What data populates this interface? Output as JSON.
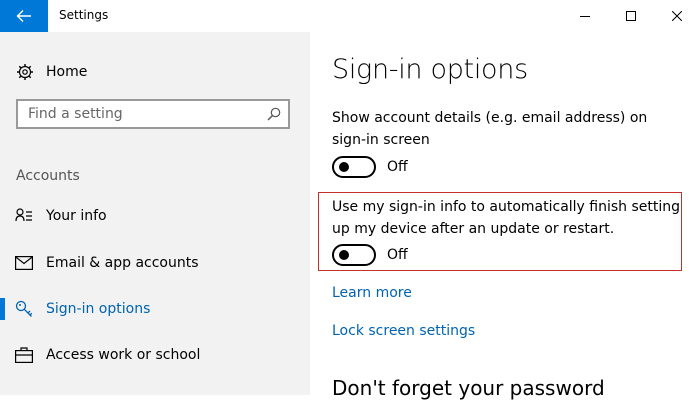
{
  "window": {
    "title": "Settings",
    "accent_color": "#0078d7",
    "controls": [
      "minimize",
      "maximize",
      "close"
    ]
  },
  "sidebar": {
    "home_label": "Home",
    "search": {
      "placeholder": "Find a setting",
      "value": ""
    },
    "section_label": "Accounts",
    "items": [
      {
        "label": "Your info",
        "icon": "person-list-icon",
        "active": false
      },
      {
        "label": "Email & app accounts",
        "icon": "mail-icon",
        "active": false
      },
      {
        "label": "Sign-in options",
        "icon": "key-icon",
        "active": true
      },
      {
        "label": "Access work or school",
        "icon": "briefcase-icon",
        "active": false
      }
    ]
  },
  "main": {
    "title": "Sign-in options",
    "settings": [
      {
        "description": "Show account details (e.g. email address) on sign-in screen",
        "state": "Off",
        "highlighted": false
      },
      {
        "description": "Use my sign-in info to automatically finish setting up my device after an update or restart.",
        "state": "Off",
        "highlighted": true,
        "highlight_color": "#c4312a"
      }
    ],
    "links": [
      "Learn more",
      "Lock screen settings"
    ],
    "next_section_title": "Don't forget your password"
  }
}
